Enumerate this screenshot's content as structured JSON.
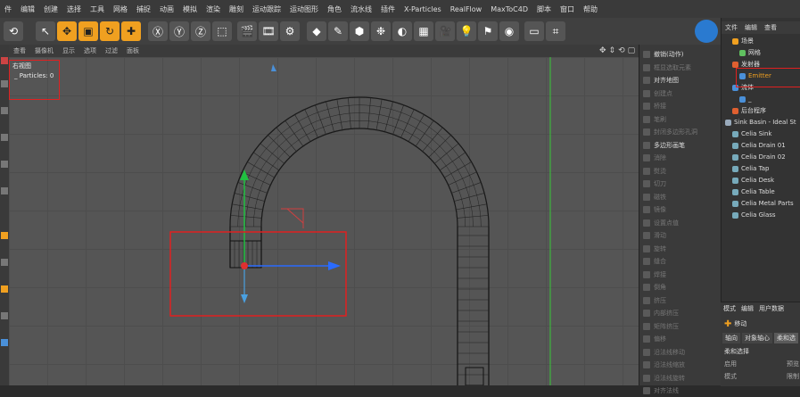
{
  "menubar": [
    "件",
    "编辑",
    "创建",
    "选择",
    "工具",
    "网格",
    "捕捉",
    "动画",
    "模拟",
    "渲染",
    "雕刻",
    "运动跟踪",
    "运动图形",
    "角色",
    "流水线",
    "插件",
    "X-Particles",
    "RealFlow",
    "MaxToC4D",
    "脚本",
    "窗口",
    "帮助"
  ],
  "viewport_menu": [
    "查看",
    "摄像机",
    "显示",
    "选项",
    "过滤",
    "面板"
  ],
  "viewport": {
    "view_name": "右视图",
    "particles_text": "_ Particles: 0"
  },
  "attr_panel": {
    "items": [
      {
        "label": "撤销(动作)",
        "active": true
      },
      {
        "label": "框显选取元素",
        "active": false
      },
      {
        "label": "对齐地图",
        "active": true
      },
      {
        "label": "创建点",
        "active": false
      },
      {
        "label": "桥接",
        "active": false
      },
      {
        "label": "笔刷",
        "active": false
      },
      {
        "label": "封闭多边形孔洞",
        "active": false
      },
      {
        "label": "多边形画笔",
        "active": true
      },
      {
        "label": "消除",
        "active": false
      },
      {
        "label": "熨烫",
        "active": false
      },
      {
        "label": "切刀",
        "active": false
      },
      {
        "label": "磁铁",
        "active": false
      },
      {
        "label": "镜像",
        "active": false
      },
      {
        "label": "设置点值",
        "active": false
      },
      {
        "label": "滑动",
        "active": false
      },
      {
        "label": "旋转",
        "active": false
      },
      {
        "label": "缝合",
        "active": false
      },
      {
        "label": "焊接",
        "active": false
      },
      {
        "label": "倒角",
        "active": false
      },
      {
        "label": "挤压",
        "active": false
      },
      {
        "label": "内部挤压",
        "active": false
      },
      {
        "label": "矩阵挤压",
        "active": false
      },
      {
        "label": "偏移",
        "active": false
      },
      {
        "label": "沿法线移动",
        "active": false
      },
      {
        "label": "沿法线缩放",
        "active": false
      },
      {
        "label": "沿法线旋转",
        "active": false
      },
      {
        "label": "对齐法线",
        "active": false
      }
    ]
  },
  "obj_panel": {
    "menu": [
      "文件",
      "编辑",
      "查看"
    ],
    "items": [
      {
        "label": "场景",
        "indent": 1,
        "color": "#f0a020"
      },
      {
        "label": "网格",
        "indent": 2,
        "color": "#60c060"
      },
      {
        "label": "发射器",
        "indent": 1,
        "color": "#e06030"
      },
      {
        "label": "Emitter",
        "indent": 2,
        "color": "#4a90d9"
      },
      {
        "label": "流体",
        "indent": 1,
        "color": "#4a90d9"
      },
      {
        "label": "_",
        "indent": 2,
        "color": "#4a90d9"
      },
      {
        "label": "后台程序",
        "indent": 1,
        "color": "#e06030"
      },
      {
        "label": "Sink Basin - Ideal St",
        "indent": 0,
        "color": "#9ab"
      },
      {
        "label": "Celia Sink",
        "indent": 1,
        "color": "#7ab"
      },
      {
        "label": "Celia Drain 01",
        "indent": 1,
        "color": "#7ab"
      },
      {
        "label": "Celia Drain 02",
        "indent": 1,
        "color": "#7ab"
      },
      {
        "label": "Celia Tap",
        "indent": 1,
        "color": "#7ab"
      },
      {
        "label": "Celia Desk",
        "indent": 1,
        "color": "#7ab"
      },
      {
        "label": "Celia Table",
        "indent": 1,
        "color": "#7ab"
      },
      {
        "label": "Celia Metal Parts",
        "indent": 1,
        "color": "#7ab"
      },
      {
        "label": "Celia Glass",
        "indent": 1,
        "color": "#7ab"
      }
    ]
  },
  "attr_bottom": {
    "menu": [
      "模式",
      "编辑",
      "用户数据"
    ],
    "tool_name": "移动",
    "tabs": [
      "轴向",
      "对象轴心",
      "柔和选"
    ],
    "section": "柔和选择",
    "fields": [
      {
        "label": "启用",
        "value": "预览"
      },
      {
        "label": "模式",
        "value": "限制"
      }
    ]
  },
  "colors": {
    "accent": "#f0a020",
    "selection_box": "#e02020",
    "axis_x": "#2a6bff",
    "axis_y": "#20c040",
    "axis_z": "#4aa0e0"
  }
}
